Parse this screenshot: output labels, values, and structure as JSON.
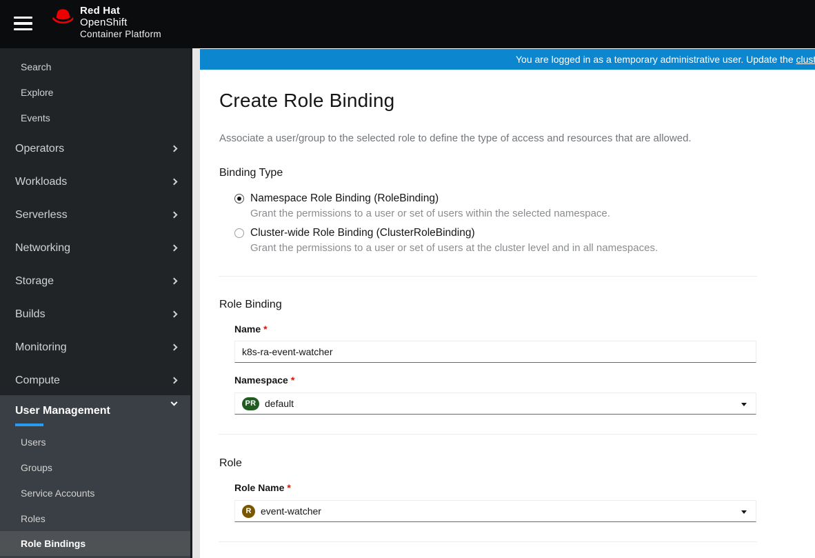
{
  "header": {
    "brand": {
      "line1": "Red Hat",
      "line2": "OpenShift",
      "line3": "Container Platform"
    }
  },
  "banner": {
    "message": "You are logged in as a temporary administrative user. Update the ",
    "link_text": "cluster"
  },
  "sidebar": {
    "top_items": [
      "Search",
      "Explore",
      "Events"
    ],
    "sections": [
      "Operators",
      "Workloads",
      "Serverless",
      "Networking",
      "Storage",
      "Builds",
      "Monitoring",
      "Compute"
    ],
    "user_management": {
      "label": "User Management",
      "items": [
        "Users",
        "Groups",
        "Service Accounts",
        "Roles"
      ],
      "active_item": "Role Bindings"
    }
  },
  "page": {
    "title": "Create Role Binding",
    "description": "Associate a user/group to the selected role to define the type of access and resources that are allowed.",
    "required_mark": "*",
    "binding_type": {
      "label": "Binding Type",
      "options": [
        {
          "label": "Namespace Role Binding (RoleBinding)",
          "help": "Grant the permissions to a user or set of users within the selected namespace.",
          "selected": true
        },
        {
          "label": "Cluster-wide Role Binding (ClusterRoleBinding)",
          "help": "Grant the permissions to a user or set of users at the cluster level and in all namespaces.",
          "selected": false
        }
      ]
    },
    "role_binding_section": {
      "label": "Role Binding",
      "name_label": "Name",
      "name_value": "k8s-ra-event-watcher",
      "namespace_label": "Namespace",
      "namespace_badge": "PR",
      "namespace_value": "default"
    },
    "role_section": {
      "label": "Role",
      "role_name_label": "Role Name",
      "role_badge": "R",
      "role_value": "event-watcher"
    }
  },
  "colors": {
    "banner_blue": "#0d86d0",
    "nav_active_underline_blue": "#2b9af3",
    "project_badge_green": "#205c20",
    "role_badge_gold": "#795600",
    "required_red": "#c9190b",
    "brand_red": "#ee0000"
  }
}
